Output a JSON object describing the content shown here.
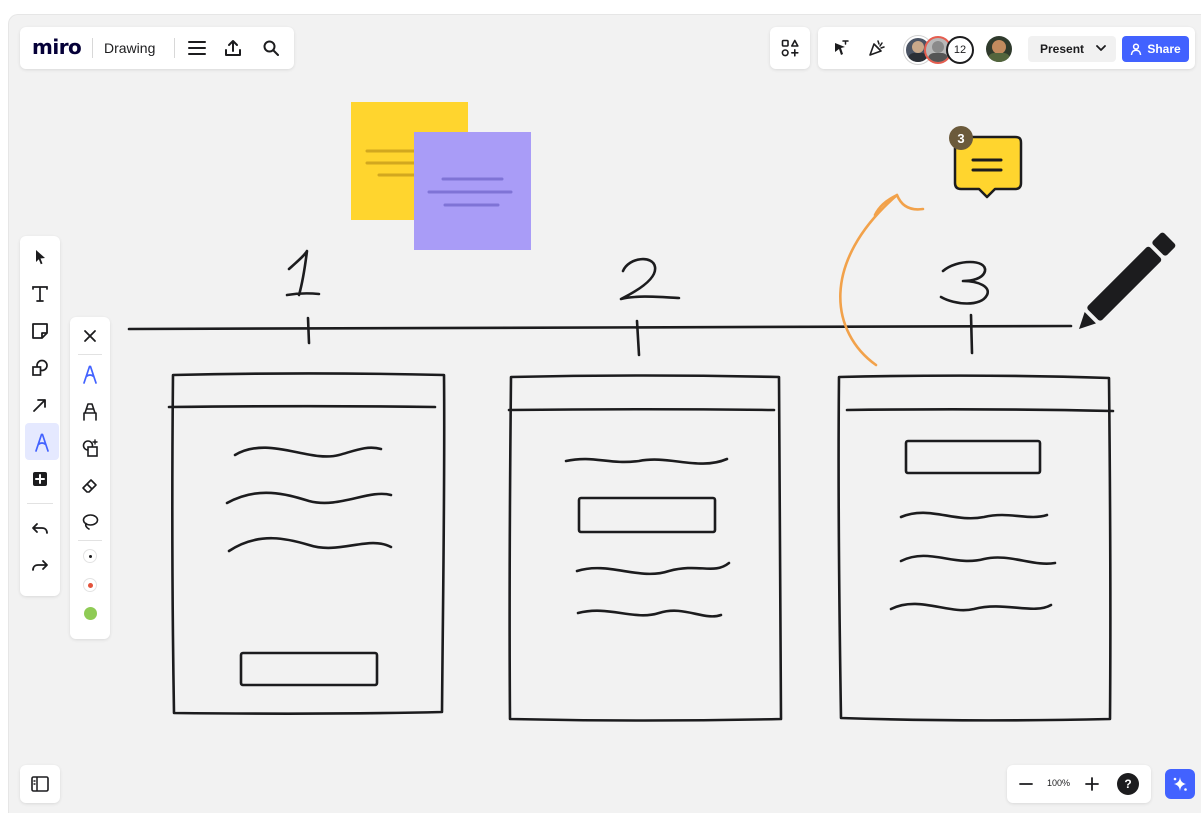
{
  "app": {
    "logo_text": "miro",
    "board_name": "Drawing"
  },
  "collaborators": {
    "overflow_count": "12"
  },
  "toolbar_right": {
    "present_label": "Present",
    "share_label": "Share"
  },
  "comment": {
    "count": "3"
  },
  "sketch": {
    "column_numbers": [
      "1",
      "2",
      "3"
    ]
  },
  "zoom": {
    "level": "100%",
    "help_label": "?"
  },
  "colors": {
    "accent": "#4262ff",
    "sticky_yellow": "#ffd52e",
    "sticky_purple": "#a99cf7",
    "comment_yellow": "#ffd52e",
    "arrow_orange": "#f2a24b",
    "canvas": "#f2f2f2",
    "pen_colors": [
      "#1c1c1e",
      "#e3533c",
      "#8fcb55"
    ]
  },
  "icons": {
    "left_toolbar": [
      "cursor-icon",
      "text-icon",
      "sticky-note-icon",
      "shapes-icon",
      "arrow-icon",
      "pen-icon",
      "add-icon",
      "undo-icon",
      "redo-icon"
    ],
    "drawing_toolbar": [
      "close-icon",
      "pen-icon",
      "highlighter-icon",
      "smart-draw-icon",
      "eraser-icon",
      "lasso-icon"
    ]
  }
}
